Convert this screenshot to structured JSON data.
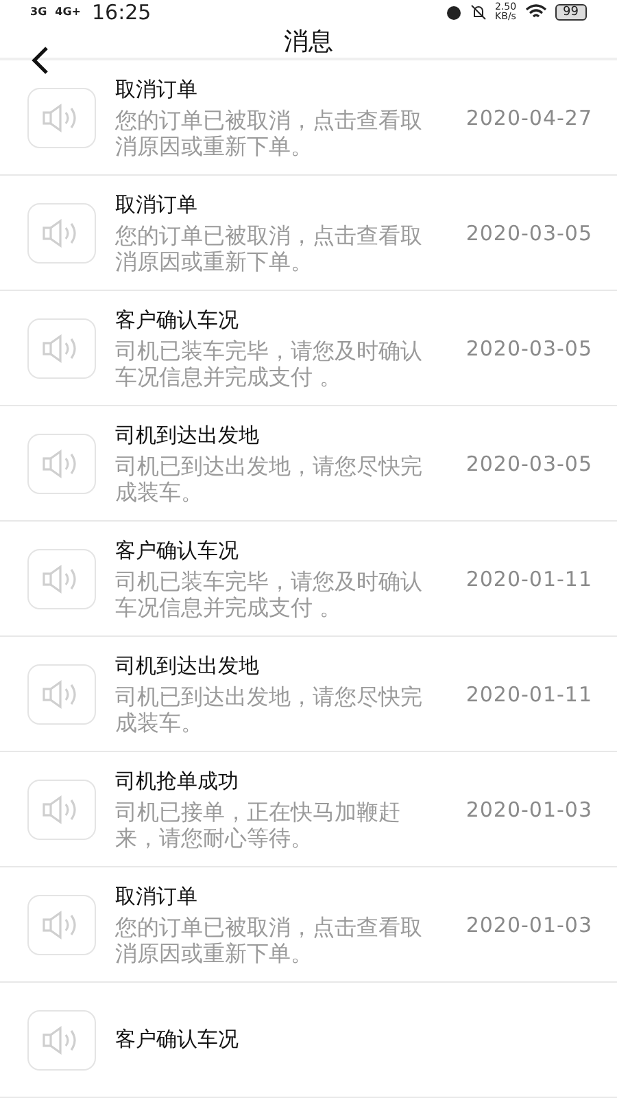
{
  "status_bar": {
    "networks": [
      "3G",
      "4G+"
    ],
    "time": "16:25",
    "speed": "2.50",
    "speed_unit": "KB/s",
    "battery": "99"
  },
  "header": {
    "title": "消息"
  },
  "messages": [
    {
      "title": "取消订单",
      "body": "您的订单已被取消，点击查看取消原因或重新下单。",
      "date": "2020-04-27"
    },
    {
      "title": "取消订单",
      "body": "您的订单已被取消，点击查看取消原因或重新下单。",
      "date": "2020-03-05"
    },
    {
      "title": "客户确认车况",
      "body": "司机已装车完毕，请您及时确认车况信息并完成支付 。",
      "date": "2020-03-05"
    },
    {
      "title": "司机到达出发地",
      "body": "司机已到达出发地，请您尽快完成装车。",
      "date": "2020-03-05"
    },
    {
      "title": "客户确认车况",
      "body": "司机已装车完毕，请您及时确认车况信息并完成支付 。",
      "date": "2020-01-11"
    },
    {
      "title": "司机到达出发地",
      "body": "司机已到达出发地，请您尽快完成装车。",
      "date": "2020-01-11"
    },
    {
      "title": "司机抢单成功",
      "body": "司机已接单，正在快马加鞭赶来，请您耐心等待。",
      "date": "2020-01-03"
    },
    {
      "title": "取消订单",
      "body": "您的订单已被取消，点击查看取消原因或重新下单。",
      "date": "2020-01-03"
    },
    {
      "title": "客户确认车况"
    }
  ]
}
